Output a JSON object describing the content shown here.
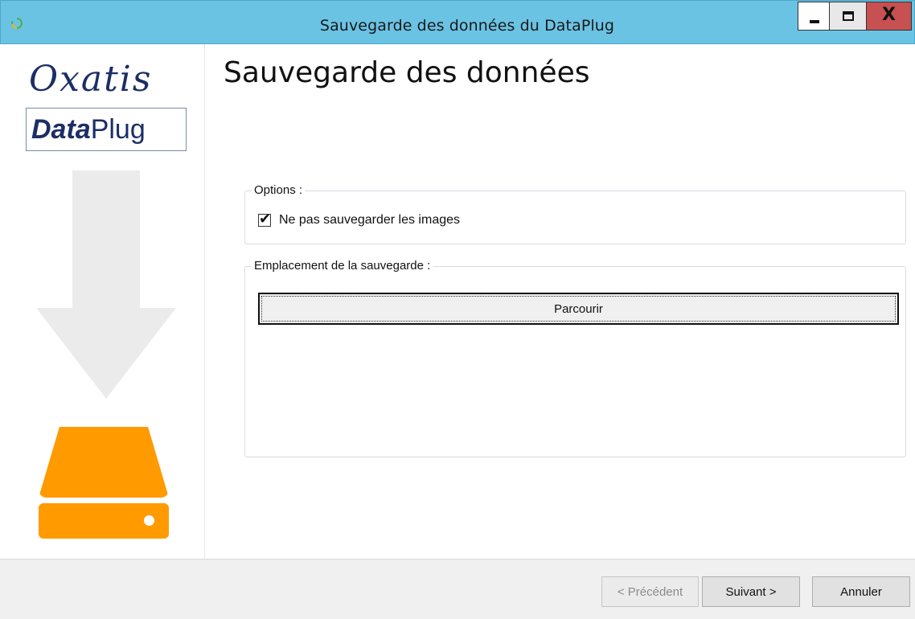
{
  "window": {
    "title": "Sauvegarde des données du DataPlug",
    "app_icon": "refresh-icon",
    "controls": {
      "minimize": "minimize-icon",
      "maximize": "maximize-icon",
      "close_label": "X"
    }
  },
  "sidebar": {
    "logo_top": "Oxatis",
    "logo_bottom_bold": "Data",
    "logo_bottom_regular": "Plug",
    "illustration": {
      "arrow": "down-arrow-icon",
      "drive": "hard-drive-icon"
    }
  },
  "main": {
    "page_title": "Sauvegarde des données",
    "options_group": {
      "legend": "Options :",
      "checkbox_label": "Ne pas sauvegarder les images",
      "checked": true
    },
    "location_group": {
      "legend": "Emplacement de la sauvegarde :",
      "browse_label": "Parcourir"
    }
  },
  "footer": {
    "prev_label": "< Précédent",
    "next_label": "Suivant >",
    "cancel_label": "Annuler"
  },
  "colors": {
    "titlebar": "#6bc3e4",
    "close_button": "#c75050",
    "logo_blue": "#1c2e66",
    "drive_orange": "#ff9a00",
    "arrow_gray": "#ebebeb"
  }
}
